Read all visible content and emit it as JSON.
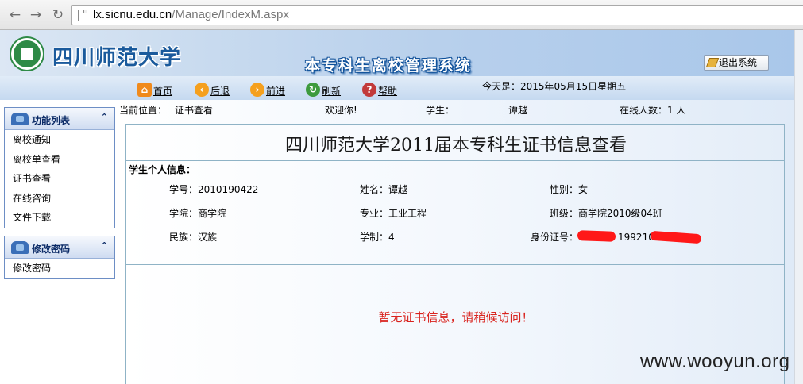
{
  "browser": {
    "url_host": "lx.sicnu.edu.cn",
    "url_path": "/Manage/IndexM.aspx"
  },
  "header": {
    "school_name": "四川师范大学",
    "system_title": "本专科生离校管理系统",
    "logout_label": "退出系统"
  },
  "toolbar": {
    "home": "首页",
    "back": "后退",
    "forward": "前进",
    "refresh": "刷新",
    "help": "帮助",
    "today": "今天是：2015年05月15日星期五"
  },
  "sidebar": {
    "panels": [
      {
        "title": "功能列表",
        "items": [
          "离校通知",
          "离校单查看",
          "证书查看",
          "在线咨询",
          "文件下载"
        ]
      },
      {
        "title": "修改密码",
        "items": [
          "修改密码"
        ]
      }
    ]
  },
  "status": {
    "location_label": "当前位置：",
    "location_value": "证书查看",
    "welcome": "欢迎你!",
    "student_label": "学生：",
    "student_name": "谭越",
    "online_label": "在线人数：",
    "online_value": "1 人"
  },
  "content": {
    "heading": "四川师范大学2011届本专科生证书信息查看",
    "info_title": "学生个人信息：",
    "fields": {
      "student_id": {
        "label": "学号：",
        "value": "2010190422"
      },
      "name": {
        "label": "姓名：",
        "value": "谭越"
      },
      "gender": {
        "label": "性别：",
        "value": "女"
      },
      "college": {
        "label": "学院：",
        "value": "商学院"
      },
      "major": {
        "label": "专业：",
        "value": "工业工程"
      },
      "class": {
        "label": "班级：",
        "value": "商学院2010级04班"
      },
      "ethnicity": {
        "label": "民族：",
        "value": "汉族"
      },
      "duration": {
        "label": "学制：",
        "value": "4"
      },
      "id_number": {
        "label": "身份证号：",
        "value": "1992101"
      }
    },
    "notice": "暂无证书信息，请稍候访问！"
  },
  "watermark": "www.wooyun.org",
  "colors": {
    "header_blue": "#1a5a9c",
    "notice_red": "#d9231e",
    "redaction_red": "#ff1818",
    "panel_border": "#6d8ec5"
  }
}
